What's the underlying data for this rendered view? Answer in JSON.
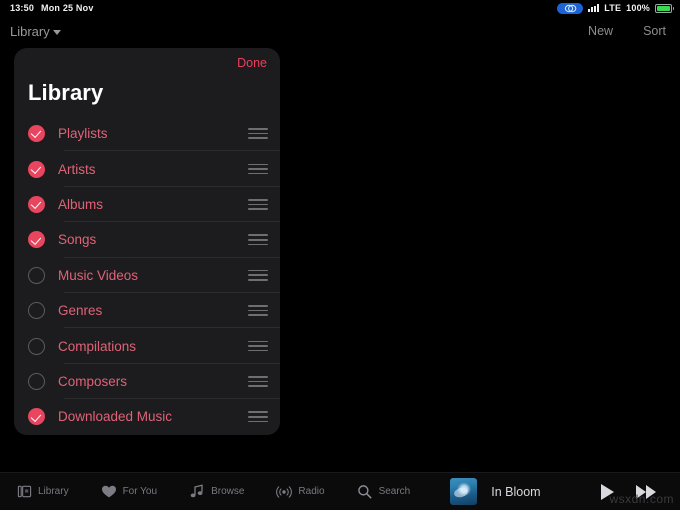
{
  "status_bar": {
    "time": "13:50",
    "date": "Mon 25 Nov",
    "recording_icon": "screen-record-icon",
    "signal_icon": "cellular-signal-icon",
    "network": "LTE",
    "battery_percent": "100%",
    "battery_icon": "battery-full-icon"
  },
  "nav_bar": {
    "title": "Library",
    "chevron_icon": "chevron-down-icon",
    "new_label": "New",
    "sort_label": "Sort"
  },
  "edit_sheet": {
    "done_label": "Done",
    "title": "Library",
    "options": [
      {
        "label": "Playlists",
        "checked": true,
        "handle_icon": "drag-handle-icon"
      },
      {
        "label": "Artists",
        "checked": true,
        "handle_icon": "drag-handle-icon"
      },
      {
        "label": "Albums",
        "checked": true,
        "handle_icon": "drag-handle-icon"
      },
      {
        "label": "Songs",
        "checked": true,
        "handle_icon": "drag-handle-icon"
      },
      {
        "label": "Music Videos",
        "checked": false,
        "handle_icon": "drag-handle-icon"
      },
      {
        "label": "Genres",
        "checked": false,
        "handle_icon": "drag-handle-icon"
      },
      {
        "label": "Compilations",
        "checked": false,
        "handle_icon": "drag-handle-icon"
      },
      {
        "label": "Composers",
        "checked": false,
        "handle_icon": "drag-handle-icon"
      },
      {
        "label": "Downloaded Music",
        "checked": true,
        "handle_icon": "drag-handle-icon"
      }
    ]
  },
  "tab_bar": {
    "tabs": [
      {
        "label": "Library",
        "icon": "library-icon"
      },
      {
        "label": "For You",
        "icon": "heart-icon"
      },
      {
        "label": "Browse",
        "icon": "music-note-icon"
      },
      {
        "label": "Radio",
        "icon": "radio-broadcast-icon"
      },
      {
        "label": "Search",
        "icon": "search-icon"
      }
    ]
  },
  "now_playing": {
    "artwork_name": "album-artwork",
    "track_title": "In Bloom",
    "play_icon": "play-icon",
    "forward_icon": "fast-forward-icon"
  },
  "watermark": {
    "text": "wsxdn.com"
  },
  "colors": {
    "accent_pink": "#e8455f",
    "label_pink": "#e06277",
    "done_red": "#e8405c",
    "sheet_bg": "#1c1c1e",
    "page_bg": "#000000",
    "battery_green": "#3ad94f",
    "record_blue": "#1e63d6"
  }
}
